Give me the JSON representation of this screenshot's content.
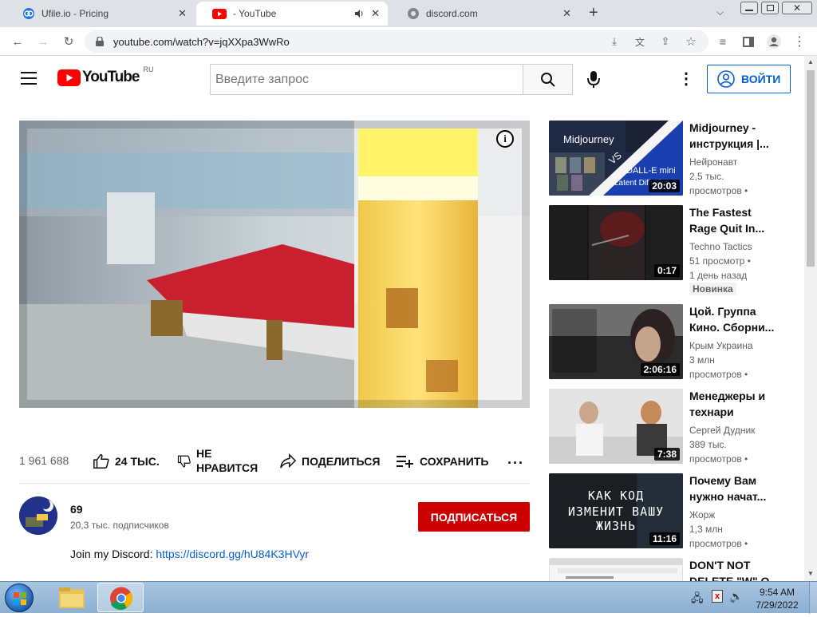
{
  "browser": {
    "tabs": [
      {
        "title": "Ufile.io - Pricing",
        "icon": "ufile-icon"
      },
      {
        "title": "- YouTube",
        "icon": "youtube-icon",
        "audio": true
      },
      {
        "title": "discord.com",
        "icon": "globe-icon"
      }
    ],
    "url": "youtube.com/watch?v=jqXXpa3WwRo"
  },
  "youtube": {
    "logo_text": "YouTube",
    "logo_region": "RU",
    "search_placeholder": "Введите запрос",
    "signin_label": "ВОЙТИ",
    "views": "1 961 688",
    "likes": "24 ТЫС.",
    "dislike_label_1": "НЕ",
    "dislike_label_2": "НРАВИТСЯ",
    "share_label": "ПОДЕЛИТЬСЯ",
    "save_label": "СОХРАНИТЬ",
    "channel_name": "69",
    "subscribers": "20,3 тыс. подписчиков",
    "subscribe_label": "ПОДПИСАТЬСЯ",
    "description_prefix": "Join my Discord: ",
    "description_link": "https://discord.gg/hU84K3HVyr",
    "accent_color": "#cc0000",
    "link_color": "#065fd4"
  },
  "recommendations": [
    {
      "title_1": "Midjourney -",
      "title_2": "инструкция |...",
      "channel": "Нейронавт",
      "meta_1": "2,5 тыс.",
      "meta_2": "просмотров •",
      "duration": "20:03",
      "thumb_text_1": "Midjourney",
      "thumb_text_2": "VS",
      "thumb_text_3": "DALL-E mini",
      "thumb_text_4": "Latent Diffusion"
    },
    {
      "title_1": "The Fastest",
      "title_2": "Rage Quit In...",
      "channel": "Techno Tactics",
      "meta_1": "51 просмотр •",
      "meta_2": "1 день назад",
      "badge": "Новинка",
      "duration": "0:17"
    },
    {
      "title_1": "Цой. Группа",
      "title_2": "Кино. Сборни...",
      "channel": "Крым Украина",
      "meta_1": "3 млн",
      "meta_2": "просмотров •",
      "duration": "2:06:16"
    },
    {
      "title_1": "Менеджеры и",
      "title_2": "технари",
      "channel": "Сергей Дудник",
      "meta_1": "389 тыс.",
      "meta_2": "просмотров •",
      "duration": "7:38"
    },
    {
      "title_1": "Почему Вам",
      "title_2": "нужно начат...",
      "channel": "Жорж",
      "meta_1": "1,3 млн",
      "meta_2": "просмотров •",
      "duration": "11:16",
      "thumb_text_1": "КАК КОД",
      "thumb_text_2": "ИЗМЕНИТ ВАШУ",
      "thumb_text_3": "ЖИЗНЬ"
    },
    {
      "title_1": "DON'T NOT",
      "title_2": "DELETE \"W\" O"
    }
  ],
  "taskbar": {
    "time": "9:54 AM",
    "date": "7/29/2022"
  }
}
